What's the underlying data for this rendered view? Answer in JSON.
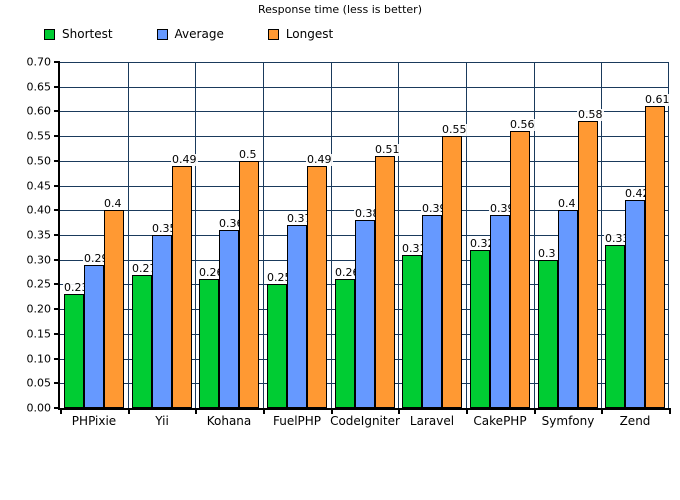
{
  "chart_data": {
    "type": "bar",
    "title": "Response time (less is better)",
    "xlabel": "",
    "ylabel": "",
    "ylim": [
      0.0,
      0.7
    ],
    "ytick_step": 0.05,
    "ytick_labels": [
      "0.00",
      "0.05",
      "0.10",
      "0.15",
      "0.20",
      "0.25",
      "0.30",
      "0.35",
      "0.40",
      "0.45",
      "0.50",
      "0.55",
      "0.60",
      "0.65",
      "0.70"
    ],
    "grid": true,
    "legend_position": "top-left",
    "categories": [
      "PHPixie",
      "Yii",
      "Kohana",
      "FuelPHP",
      "CodeIgniter",
      "Laravel",
      "CakePHP",
      "Symfony",
      "Zend"
    ],
    "series": [
      {
        "name": "Shortest",
        "color": "#00cc33",
        "values": [
          0.23,
          0.27,
          0.26,
          0.25,
          0.26,
          0.31,
          0.32,
          0.3,
          0.33
        ],
        "labels": [
          "0.23",
          "0.27",
          "0.26",
          "0.25",
          "0.26",
          "0.31",
          "0.32",
          "0.3",
          "0.33"
        ]
      },
      {
        "name": "Average",
        "color": "#6699ff",
        "values": [
          0.29,
          0.35,
          0.36,
          0.37,
          0.38,
          0.39,
          0.39,
          0.4,
          0.42
        ],
        "labels": [
          "0.29",
          "0.35",
          "0.36",
          "0.37",
          "0.38",
          "0.39",
          "0.39",
          "0.4",
          "0.42"
        ]
      },
      {
        "name": "Longest",
        "color": "#ff9933",
        "values": [
          0.4,
          0.49,
          0.5,
          0.49,
          0.51,
          0.55,
          0.56,
          0.58,
          0.61
        ],
        "labels": [
          "0.4",
          "0.49",
          "0.5",
          "0.49",
          "0.51",
          "0.55",
          "0.56",
          "0.58",
          "0.61"
        ]
      }
    ]
  },
  "colors": {
    "shortest": "#00cc33",
    "average": "#6699ff",
    "longest": "#ff9933",
    "grid": "#1a3a5c",
    "axis": "#000000",
    "background": "#ffffff"
  }
}
